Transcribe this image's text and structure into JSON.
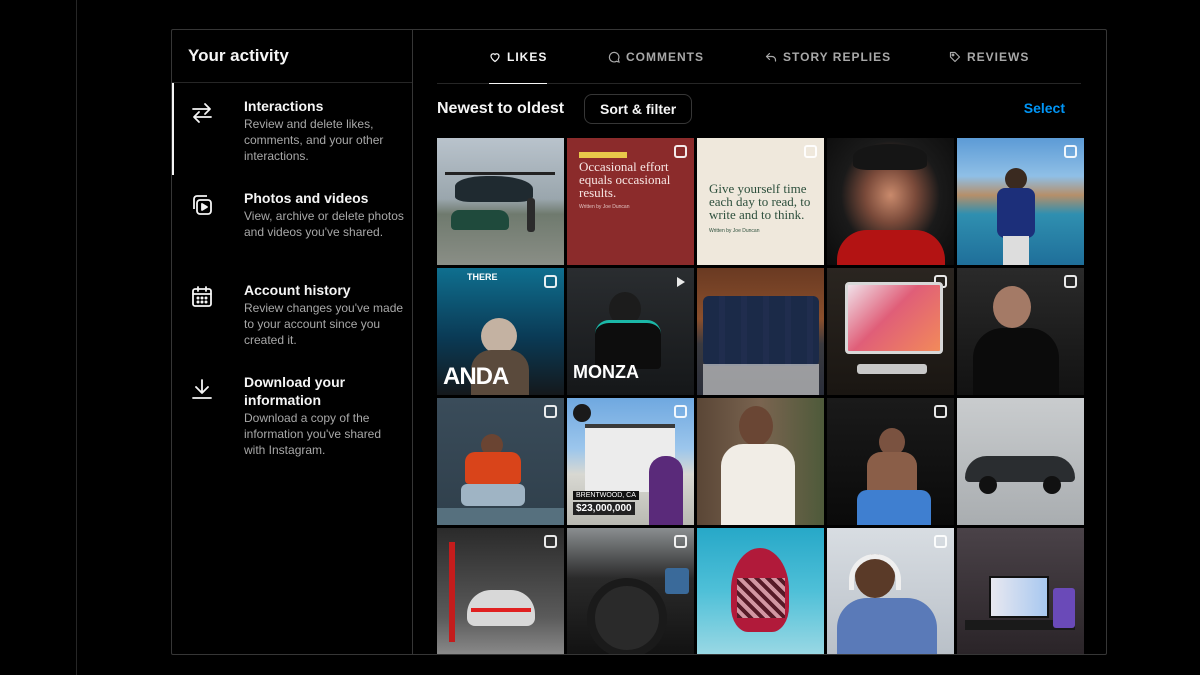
{
  "sidebar": {
    "title": "Your activity",
    "items": [
      {
        "label": "Interactions",
        "desc": "Review and delete likes, comments, and your other interactions.",
        "icon": "arrows-swap-icon"
      },
      {
        "label": "Photos and videos",
        "desc": "View, archive or delete photos and videos you've shared.",
        "icon": "photo-video-icon"
      },
      {
        "label": "Account history",
        "desc": "Review changes you've made to your account since you created it.",
        "icon": "calendar-icon"
      },
      {
        "label": "Download your information",
        "desc": "Download a copy of the information you've shared with Instagram.",
        "icon": "download-icon"
      }
    ]
  },
  "tabs": [
    {
      "label": "LIKES",
      "icon": "heart-icon",
      "active": true
    },
    {
      "label": "COMMENTS",
      "icon": "comment-icon",
      "active": false
    },
    {
      "label": "STORY REPLIES",
      "icon": "reply-icon",
      "active": false
    },
    {
      "label": "REVIEWS",
      "icon": "tag-icon",
      "active": false
    }
  ],
  "toolbar": {
    "sort_label": "Newest to oldest",
    "sort_button": "Sort & filter",
    "select_link": "Select"
  },
  "grid": {
    "overlays": {
      "quote1": "Occasional effort equals occasional results.",
      "quote1_byline": "Written by Joe Duncan",
      "quote2": "Give yourself time each day to read, to write and to think.",
      "quote2_byline": "Written by Joe Duncan",
      "there": "THERE",
      "anda": "ANDA",
      "monza": "MONZA",
      "brentwood": "BRENTWOOD, CA",
      "price": "$23,000,000"
    },
    "colors": {
      "accent_link": "#0095f6",
      "quote1_bg": "#8b2b2b",
      "quote2_bg": "#efe8dc"
    }
  }
}
